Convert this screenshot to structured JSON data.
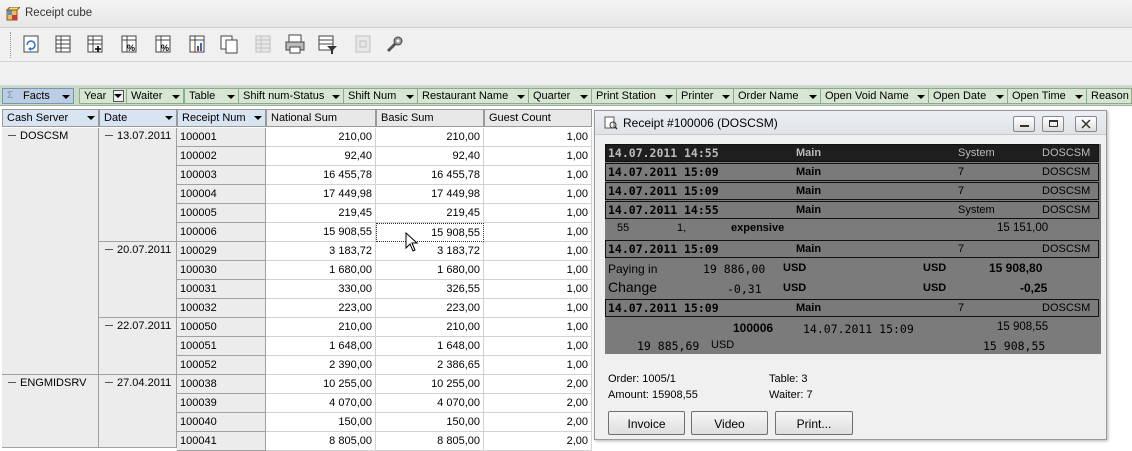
{
  "window": {
    "title": "Receipt cube"
  },
  "toolbar": {
    "buttons": [
      "refresh-icon",
      "grid-icon",
      "grid-add-icon",
      "percent-icon",
      "percent-alt-icon",
      "chart-icon",
      "copy-icon",
      "grid-disabled-icon",
      "print-icon",
      "filter-icon",
      "export-disabled-icon",
      "tools-icon"
    ]
  },
  "field_bar": {
    "facts_label": "Facts",
    "fields": [
      "Year",
      "Waiter",
      "Table",
      "Shift num-Status",
      "Shift Num",
      "Restaurant Name",
      "Quarter",
      "Print Station",
      "Printer",
      "Order Name",
      "Open Void Name",
      "Open Date",
      "Open Time",
      "Reason"
    ]
  },
  "grid": {
    "row_headers": [
      "Cash Server",
      "Date",
      "Receipt Num"
    ],
    "columns": [
      "National Sum",
      "Basic Sum",
      "Guest Count"
    ],
    "servers": [
      "DOSCSM",
      "ENGMIDSRV"
    ],
    "dates": [
      "13.07.2011",
      "20.07.2011",
      "22.07.2011",
      "27.04.2011"
    ],
    "rows": [
      {
        "receipt": "100001",
        "national": "210,00",
        "basic": "210,00",
        "guests": "1,00"
      },
      {
        "receipt": "100002",
        "national": "92,40",
        "basic": "92,40",
        "guests": "1,00"
      },
      {
        "receipt": "100003",
        "national": "16 455,78",
        "basic": "16 455,78",
        "guests": "1,00"
      },
      {
        "receipt": "100004",
        "national": "17 449,98",
        "basic": "17 449,98",
        "guests": "1,00"
      },
      {
        "receipt": "100005",
        "national": "219,45",
        "basic": "219,45",
        "guests": "1,00"
      },
      {
        "receipt": "100006",
        "national": "15 908,55",
        "basic": "15 908,55",
        "guests": "1,00"
      },
      {
        "receipt": "100029",
        "national": "3 183,72",
        "basic": "3 183,72",
        "guests": "1,00"
      },
      {
        "receipt": "100030",
        "national": "1 680,00",
        "basic": "1 680,00",
        "guests": "1,00"
      },
      {
        "receipt": "100031",
        "national": "330,00",
        "basic": "326,55",
        "guests": "1,00"
      },
      {
        "receipt": "100032",
        "national": "223,00",
        "basic": "223,00",
        "guests": "1,00"
      },
      {
        "receipt": "100050",
        "national": "210,00",
        "basic": "210,00",
        "guests": "1,00"
      },
      {
        "receipt": "100051",
        "national": "1 648,00",
        "basic": "1 648,00",
        "guests": "1,00"
      },
      {
        "receipt": "100052",
        "national": "2 390,00",
        "basic": "2 386,65",
        "guests": "1,00"
      },
      {
        "receipt": "100038",
        "national": "10 255,00",
        "basic": "10 255,00",
        "guests": "2,00"
      },
      {
        "receipt": "100039",
        "national": "4 070,00",
        "basic": "4 070,00",
        "guests": "2,00"
      },
      {
        "receipt": "100040",
        "national": "150,00",
        "basic": "150,00",
        "guests": "2,00"
      },
      {
        "receipt": "100041",
        "national": "8 805,00",
        "basic": "8 805,00",
        "guests": "2,00"
      }
    ]
  },
  "dialog": {
    "title": "Receipt #100006 (DOSCSM)",
    "bars": [
      {
        "date": "14.07.2011",
        "time": "14:55",
        "name": "Main",
        "role": "System",
        "server": "DOSCSM"
      },
      {
        "date": "14.07.2011",
        "time": "15:09",
        "name": "Main",
        "role": "7",
        "server": "DOSCSM"
      },
      {
        "date": "14.07.2011",
        "time": "15:09",
        "name": "Main",
        "role": "7",
        "server": "DOSCSM"
      },
      {
        "date": "14.07.2011",
        "time": "14:55",
        "name": "Main",
        "role": "System",
        "server": "DOSCSM"
      },
      {
        "date": "14.07.2011",
        "time": "15:09",
        "name": "Main",
        "role": "7",
        "server": "DOSCSM"
      },
      {
        "date": "14.07.2011",
        "time": "15:09",
        "name": "Main",
        "role": "7",
        "server": "DOSCSM"
      }
    ],
    "item": {
      "qty": "55",
      "mult": "1,",
      "name": "expensive",
      "sum": "15 151,00"
    },
    "paying": {
      "label": "Paying in",
      "amount": "19 886,00",
      "cur1": "USD",
      "cur2": "USD",
      "total": "15 908,80"
    },
    "change": {
      "label": "Change",
      "amount": "-0,31",
      "cur1": "USD",
      "cur2": "USD",
      "total": "-0,25"
    },
    "summary": {
      "receipt": "100006",
      "datetime": "14.07.2011 15:09",
      "total": "15 908,55"
    },
    "summary2": {
      "amount": "19 885,69",
      "cur": "USD",
      "total": "15 908,55"
    },
    "order": "Order: 1005/1",
    "amount": "Amount: 15908,55",
    "table": "Table: 3",
    "waiter": "Waiter: 7",
    "buttons": {
      "invoice": "Invoice",
      "video": "Video",
      "print": "Print..."
    }
  }
}
